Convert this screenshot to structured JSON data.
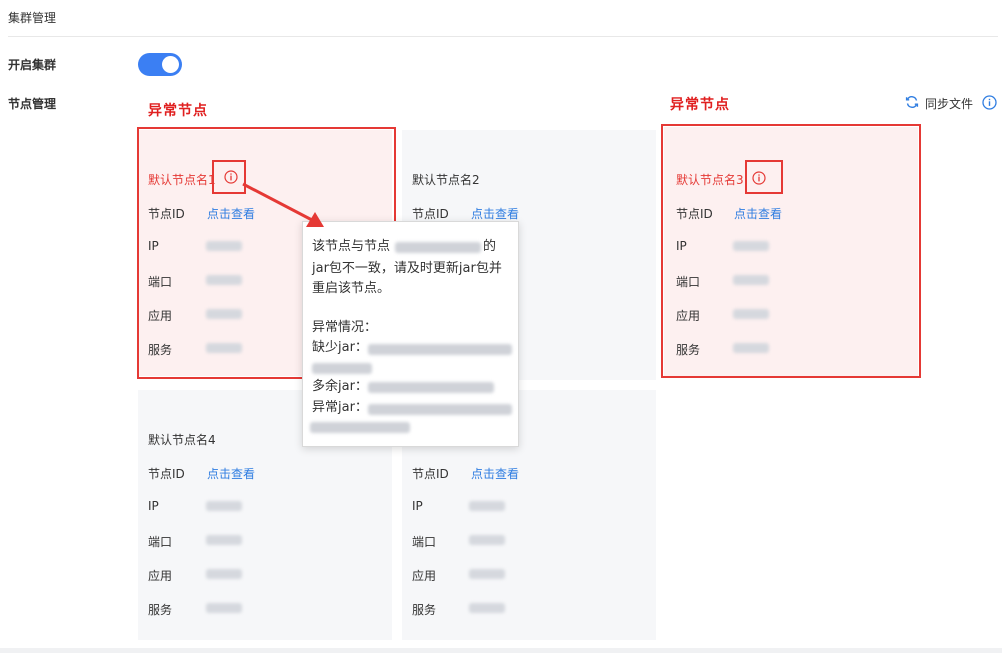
{
  "section_title": "集群管理",
  "cluster_label": "开启集群",
  "cluster_enabled": true,
  "nodes_label": "节点管理",
  "annotations": {
    "abnormal_1": "异常节点",
    "abnormal_3": "异常节点"
  },
  "sync": {
    "label": "同步文件",
    "icon": "refresh-icon"
  },
  "field_labels": {
    "id": "节点ID",
    "ip": "IP",
    "port": "端口",
    "app": "应用",
    "service": "服务"
  },
  "view_link": "点击查看",
  "nodes": [
    {
      "name": "默认节点名1",
      "status": "error"
    },
    {
      "name": "默认节点名2",
      "status": "normal"
    },
    {
      "name": "默认节点名3",
      "status": "error"
    },
    {
      "name": "默认节点名4",
      "status": "normal"
    },
    {
      "name": "",
      "status": "normal"
    }
  ],
  "tooltip": {
    "line1_pre": "该节点与节点",
    "line1_post": "的",
    "line2": "jar包不一致，请及时更新jar包并",
    "line3": "重启该节点。",
    "heading": "异常情况：",
    "missing": "缺少jar：",
    "extra": "多余jar：",
    "abnormal": "异常jar："
  },
  "colors": {
    "accent": "#3b7ff3",
    "link": "#2f7de1",
    "error": "#e53935"
  }
}
